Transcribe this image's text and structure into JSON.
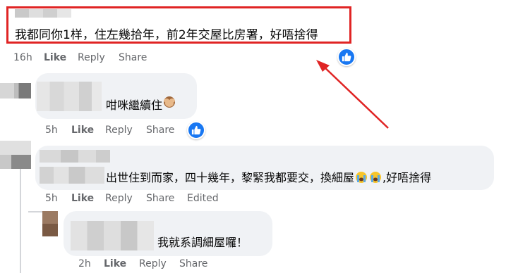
{
  "comment1": {
    "text": "我都同你1样，住左幾拾年，前2年交屋比房署，好唔捨得",
    "time": "16h",
    "like_label": "Like",
    "reply_label": "Reply",
    "share_label": "Share"
  },
  "comment2": {
    "text": "咁咪繼續住",
    "emoji_icon": "see-no-evil-monkey-icon",
    "time": "5h",
    "like_label": "Like",
    "reply_label": "Reply",
    "share_label": "Share"
  },
  "comment3": {
    "text_a": "出世住到而家，四十幾年，黎緊我都要交，換細屋",
    "emoji_icon": "loudly-crying-face-icon",
    "text_b": ",好唔捨得",
    "time": "5h",
    "like_label": "Like",
    "reply_label": "Reply",
    "share_label": "Share",
    "edited_label": "Edited"
  },
  "reply1": {
    "text": "我就系調細屋囉！",
    "time": "2h",
    "like_label": "Like",
    "reply_label": "Reply",
    "share_label": "Share"
  },
  "colors": {
    "annotation_red": "#e02424",
    "like_blue": "#1877f2",
    "bubble_gray": "#f0f2f5",
    "meta_gray": "#65676b"
  }
}
